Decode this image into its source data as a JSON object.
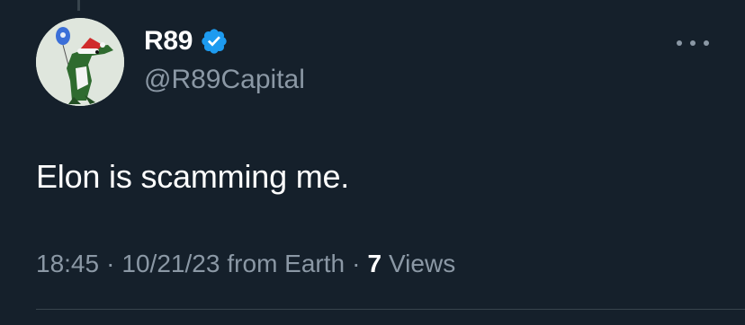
{
  "tweet": {
    "author": {
      "display_name": "R89",
      "handle": "@R89Capital",
      "verified": true,
      "avatar_icon": "dinosaur-santa-hat-avatar",
      "verified_icon": "verified-badge-icon"
    },
    "text": "Elon is scamming me.",
    "meta": {
      "time": "18:45",
      "separator": "·",
      "date": "10/21/23",
      "source": "from Earth",
      "views_count": "7",
      "views_label": "Views"
    },
    "more_icon": "more-options-icon"
  },
  "colors": {
    "background": "#15202b",
    "primary_text": "#ffffff",
    "secondary_text": "#8b98a5",
    "verified_blue": "#1d9bf0",
    "divider": "#38444d"
  }
}
